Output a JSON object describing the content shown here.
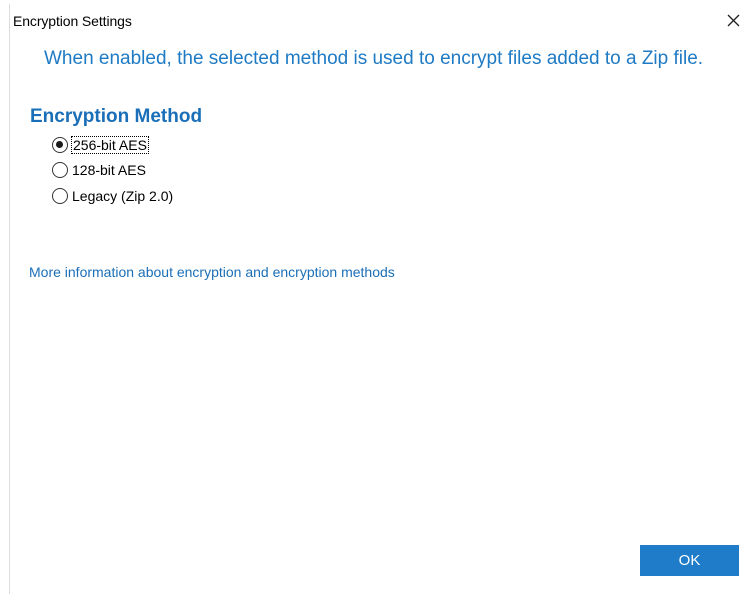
{
  "window": {
    "title": "Encryption Settings",
    "close_icon": "close-icon"
  },
  "banner": {
    "text": "When enabled, the selected method is used to encrypt files added to a Zip file."
  },
  "encryption": {
    "heading": "Encryption Method",
    "options": [
      {
        "label": "256-bit AES",
        "selected": true
      },
      {
        "label": "128-bit AES",
        "selected": false
      },
      {
        "label": "Legacy (Zip 2.0)",
        "selected": false
      }
    ]
  },
  "link": {
    "text": "More information about encryption and encryption methods"
  },
  "buttons": {
    "ok_label": "OK"
  },
  "colors": {
    "accent_text": "#1f7ac4",
    "heading": "#1a6fb8",
    "ok_button_bg": "#1e7cc8"
  }
}
